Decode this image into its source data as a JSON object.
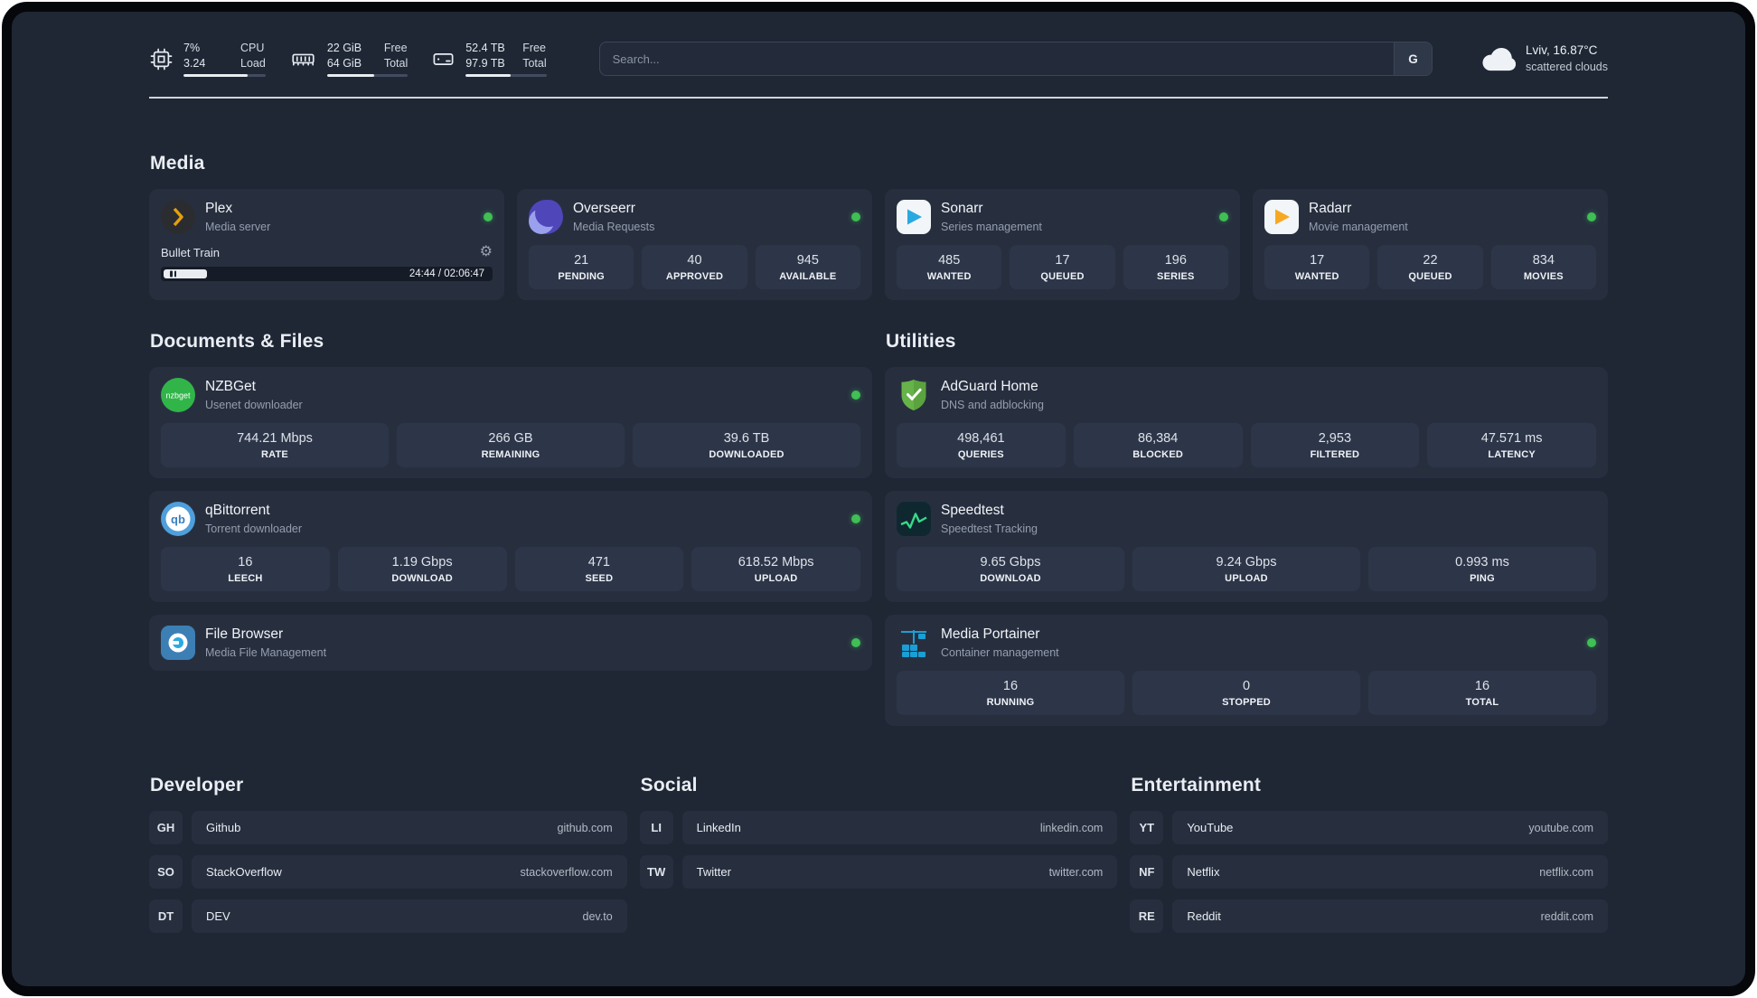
{
  "topbar": {
    "cpu": {
      "value": "7%",
      "secondary": "3.24",
      "label1": "CPU",
      "label2": "Load",
      "bar_percent": 78
    },
    "ram": {
      "value": "22 GiB",
      "secondary": "64 GiB",
      "label1": "Free",
      "label2": "Total",
      "bar_percent": 58
    },
    "disk": {
      "value": "52.4 TB",
      "secondary": "97.9 TB",
      "label1": "Free",
      "label2": "Total",
      "bar_percent": 56
    },
    "search": {
      "placeholder": "Search...",
      "engine_button": "G"
    },
    "weather": {
      "location": "Lviv, 16.87°C",
      "condition": "scattered clouds"
    }
  },
  "media": {
    "title": "Media",
    "plex": {
      "name": "Plex",
      "subtitle": "Media server",
      "now_playing": "Bullet Train",
      "time": "24:44 / 02:06:47",
      "progress_percent": 13
    },
    "overseerr": {
      "name": "Overseerr",
      "subtitle": "Media Requests",
      "stats": [
        {
          "value": "21",
          "label": "PENDING"
        },
        {
          "value": "40",
          "label": "APPROVED"
        },
        {
          "value": "945",
          "label": "AVAILABLE"
        }
      ]
    },
    "sonarr": {
      "name": "Sonarr",
      "subtitle": "Series management",
      "stats": [
        {
          "value": "485",
          "label": "WANTED"
        },
        {
          "value": "17",
          "label": "QUEUED"
        },
        {
          "value": "196",
          "label": "SERIES"
        }
      ]
    },
    "radarr": {
      "name": "Radarr",
      "subtitle": "Movie management",
      "stats": [
        {
          "value": "17",
          "label": "WANTED"
        },
        {
          "value": "22",
          "label": "QUEUED"
        },
        {
          "value": "834",
          "label": "MOVIES"
        }
      ]
    }
  },
  "documents": {
    "title": "Documents & Files",
    "nzbget": {
      "name": "NZBGet",
      "subtitle": "Usenet downloader",
      "stats": [
        {
          "value": "744.21 Mbps",
          "label": "RATE"
        },
        {
          "value": "266 GB",
          "label": "REMAINING"
        },
        {
          "value": "39.6 TB",
          "label": "DOWNLOADED"
        }
      ]
    },
    "qbittorrent": {
      "name": "qBittorrent",
      "subtitle": "Torrent downloader",
      "stats": [
        {
          "value": "16",
          "label": "LEECH"
        },
        {
          "value": "1.19 Gbps",
          "label": "DOWNLOAD"
        },
        {
          "value": "471",
          "label": "SEED"
        },
        {
          "value": "618.52 Mbps",
          "label": "UPLOAD"
        }
      ]
    },
    "filebrowser": {
      "name": "File Browser",
      "subtitle": "Media File Management"
    }
  },
  "utilities": {
    "title": "Utilities",
    "adguard": {
      "name": "AdGuard Home",
      "subtitle": "DNS and adblocking",
      "stats": [
        {
          "value": "498,461",
          "label": "QUERIES"
        },
        {
          "value": "86,384",
          "label": "BLOCKED"
        },
        {
          "value": "2,953",
          "label": "FILTERED"
        },
        {
          "value": "47.571 ms",
          "label": "LATENCY"
        }
      ]
    },
    "speedtest": {
      "name": "Speedtest",
      "subtitle": "Speedtest Tracking",
      "stats": [
        {
          "value": "9.65 Gbps",
          "label": "DOWNLOAD"
        },
        {
          "value": "9.24 Gbps",
          "label": "UPLOAD"
        },
        {
          "value": "0.993 ms",
          "label": "PING"
        }
      ]
    },
    "portainer": {
      "name": "Media Portainer",
      "subtitle": "Container management",
      "stats": [
        {
          "value": "16",
          "label": "RUNNING"
        },
        {
          "value": "0",
          "label": "STOPPED"
        },
        {
          "value": "16",
          "label": "TOTAL"
        }
      ]
    }
  },
  "links": {
    "developer": {
      "title": "Developer",
      "items": [
        {
          "badge": "GH",
          "name": "Github",
          "url": "github.com"
        },
        {
          "badge": "SO",
          "name": "StackOverflow",
          "url": "stackoverflow.com"
        },
        {
          "badge": "DT",
          "name": "DEV",
          "url": "dev.to"
        }
      ]
    },
    "social": {
      "title": "Social",
      "items": [
        {
          "badge": "LI",
          "name": "LinkedIn",
          "url": "linkedin.com"
        },
        {
          "badge": "TW",
          "name": "Twitter",
          "url": "twitter.com"
        }
      ]
    },
    "entertainment": {
      "title": "Entertainment",
      "items": [
        {
          "badge": "YT",
          "name": "YouTube",
          "url": "youtube.com"
        },
        {
          "badge": "NF",
          "name": "Netflix",
          "url": "netflix.com"
        },
        {
          "badge": "RE",
          "name": "Reddit",
          "url": "reddit.com"
        }
      ]
    }
  },
  "colors": {
    "status_online": "#3fbf54",
    "plex_accent": "#e5a00d"
  }
}
